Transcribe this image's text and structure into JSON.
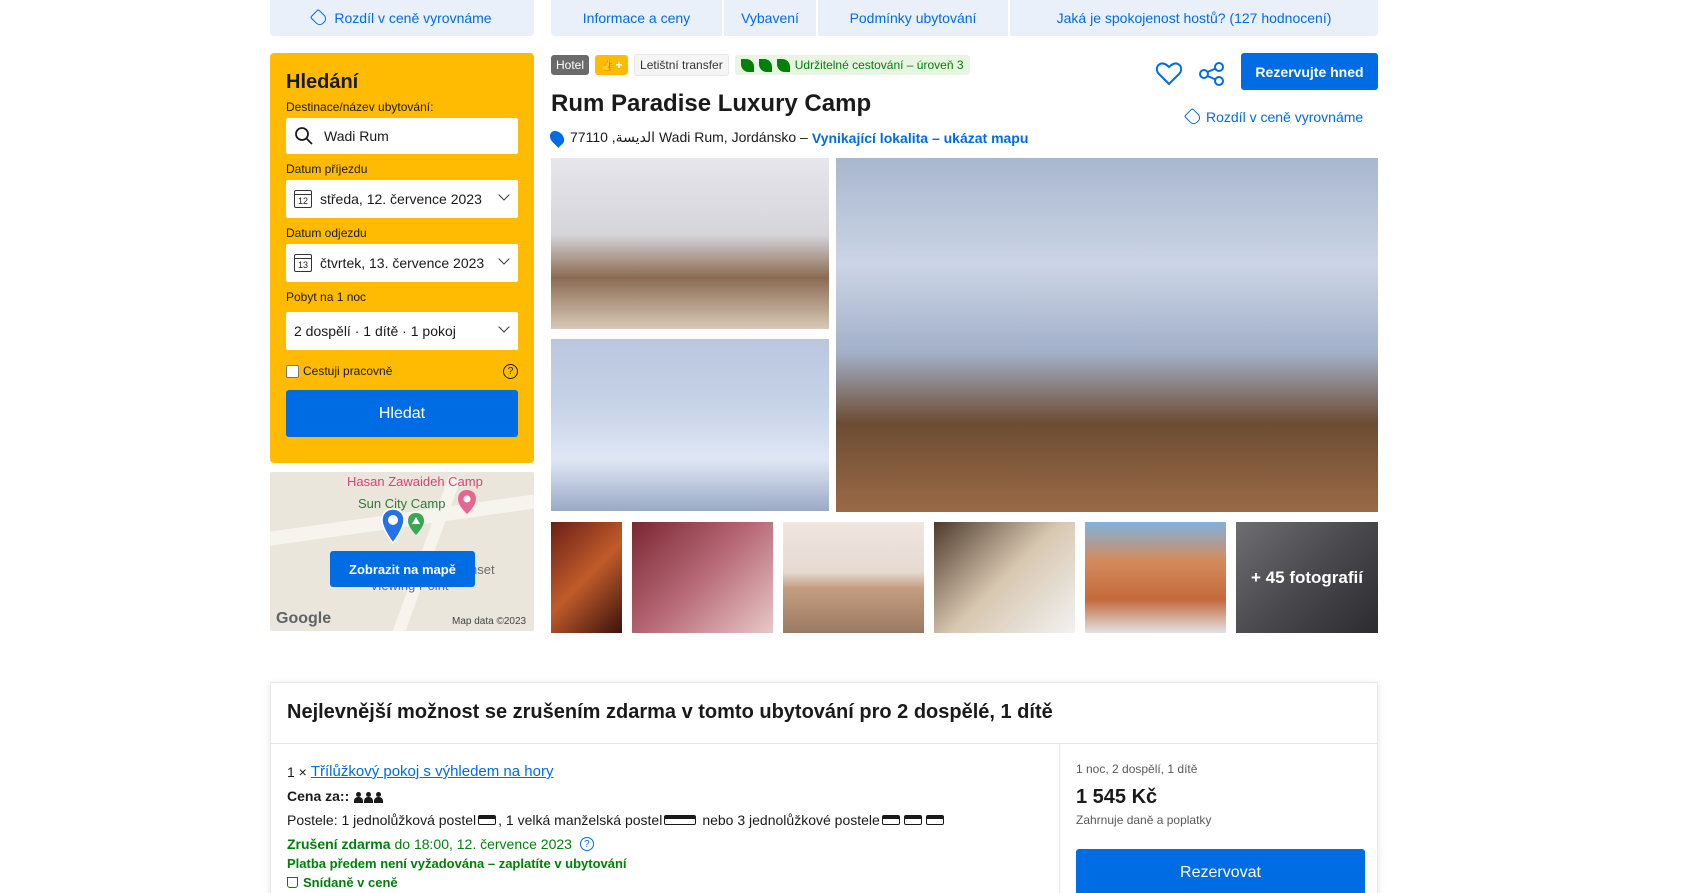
{
  "nav": {
    "price_match": "Rozdíl v ceně vyrovnáme",
    "tabs": [
      "Informace a ceny",
      "Vybavení",
      "Podmínky ubytování",
      "Jaká je spokojenost hostů? (127 hodnocení)"
    ]
  },
  "search": {
    "title": "Hledání",
    "destination_label": "Destinace/název ubytování:",
    "destination_value": "Wadi Rum",
    "checkin_label": "Datum příjezdu",
    "checkin_day": "12",
    "checkin_value": "středa, 12. července 2023",
    "checkout_label": "Datum odjezdu",
    "checkout_day": "13",
    "checkout_value": "čtvrtek, 13. července 2023",
    "stay_label": "Pobyt na 1 noc",
    "guests_value": "2 dospělí · 1 dítě · 1 pokoj",
    "business_label": "Cestuji pracovně",
    "help": "?",
    "button": "Hledat"
  },
  "map": {
    "label_camp1": "Hasan Zawaideh Camp",
    "label_camp2": "Sun City Camp",
    "label_sunset": "nset",
    "label_viewing": "Viewing Point",
    "google": "Google",
    "copyright": "Map data ©2023",
    "button": "Zobrazit na mapě"
  },
  "property": {
    "badge_type": "Hotel",
    "badge_like": "👍+",
    "badge_transfer": "Letištní transfer",
    "badge_eco": "Udržitelné cestování – úroveň 3",
    "name": "Rum Paradise Luxury Camp",
    "address": "77110 ,الديسة Wadi Rum, Jordánsko –",
    "location_link": "Vynikající lokalita – ukázat mapu",
    "book_button": "Rezervujte hned",
    "price_match": "Rozdíl v ceně vyrovnáme",
    "more_photos": "+ 45 fotografií"
  },
  "offer": {
    "heading": "Nejlevnější možnost se zrušením zdarma v tomto ubytování pro 2 dospělé, 1 dítě",
    "qty": "1 ×",
    "room_link": "Třílůžkový pokoj s výhledem na hory",
    "price_for": "Cena za::",
    "beds_a": "Postele: 1 jednolůžková postel",
    "beds_b": ", 1 velká manželská postel",
    "beds_c": "nebo 3 jednolůžkové postele",
    "cancel_bold": "Zrušení zdarma",
    "cancel_rest": "do 18:00, 12. července 2023",
    "prepay": "Platba předem není vyžadována – zaplatíte v ubytování",
    "breakfast": "Snídaně v ceně",
    "summary": "1 noc, 2 dospělí, 1 dítě",
    "price": "1 545 Kč",
    "taxes": "Zahrnuje daně a poplatky",
    "reserve_button": "Rezervovat"
  }
}
